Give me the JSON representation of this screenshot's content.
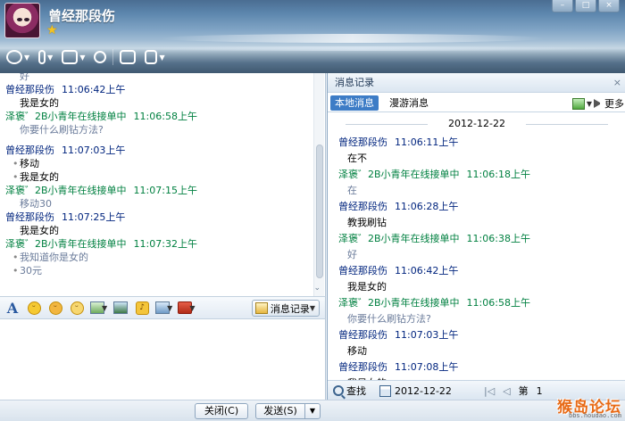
{
  "header": {
    "contact_name": "曾经那段伤",
    "window_controls": [
      "–",
      "□",
      "×"
    ],
    "toolbar": [
      {
        "name": "video-icon"
      },
      {
        "name": "microphone-icon"
      },
      {
        "name": "file-transfer-icon"
      },
      {
        "name": "add-contact-icon"
      },
      {
        "name": "remote-desktop-icon"
      },
      {
        "name": "application-icon"
      }
    ]
  },
  "chat": {
    "messages": [
      {
        "type": "body",
        "role": "other",
        "text": "好"
      },
      {
        "type": "header",
        "role": "me",
        "name": "曾经那段伤",
        "time": "11:06:42上午"
      },
      {
        "type": "body",
        "role": "me",
        "text": "我是女的"
      },
      {
        "type": "header",
        "role": "other",
        "name": "泽褒゛2B小青年在线接单中",
        "time": "11:06:58上午"
      },
      {
        "type": "body",
        "role": "other",
        "text": "你要什么刷钻方法?"
      },
      {
        "type": "gap"
      },
      {
        "type": "header",
        "role": "me",
        "name": "曾经那段伤",
        "time": "11:07:03上午"
      },
      {
        "type": "body",
        "role": "me",
        "dot": true,
        "text": "移动"
      },
      {
        "type": "body",
        "role": "me",
        "dot": true,
        "text": "我是女的"
      },
      {
        "type": "header",
        "role": "other",
        "name": "泽褒゛2B小青年在线接单中",
        "time": "11:07:15上午"
      },
      {
        "type": "body",
        "role": "other",
        "text": "移动30"
      },
      {
        "type": "header",
        "role": "me",
        "name": "曾经那段伤",
        "time": "11:07:25上午"
      },
      {
        "type": "body",
        "role": "me",
        "text": "我是女的"
      },
      {
        "type": "header",
        "role": "other",
        "name": "泽褒゛2B小青年在线接单中",
        "time": "11:07:32上午"
      },
      {
        "type": "body",
        "role": "other",
        "dot": true,
        "text": "我知道你是女的"
      },
      {
        "type": "body",
        "role": "other",
        "dot": true,
        "text": "30元"
      }
    ]
  },
  "input_toolbar": {
    "font_label": "A",
    "history_label": "消息记录"
  },
  "buttons": {
    "close": "关闭(C)",
    "send": "发送(S)",
    "send_dropdown": "▼"
  },
  "history": {
    "title": "消息记录",
    "close": "×",
    "tabs": [
      "本地消息",
      "漫游消息"
    ],
    "more": "更多",
    "date": "2012-12-22",
    "messages": [
      {
        "type": "header",
        "role": "me",
        "name": "曾经那段伤",
        "time": "11:06:11上午"
      },
      {
        "type": "body",
        "role": "me",
        "text": "在不"
      },
      {
        "type": "header",
        "role": "other",
        "name": "泽褒゛2B小青年在线接单中",
        "time": "11:06:18上午"
      },
      {
        "type": "body",
        "role": "other",
        "text": "在"
      },
      {
        "type": "header",
        "role": "me",
        "name": "曾经那段伤",
        "time": "11:06:28上午"
      },
      {
        "type": "body",
        "role": "me",
        "text": "教我刷钻"
      },
      {
        "type": "header",
        "role": "other",
        "name": "泽褒゛2B小青年在线接单中",
        "time": "11:06:38上午"
      },
      {
        "type": "body",
        "role": "other",
        "text": "好"
      },
      {
        "type": "header",
        "role": "me",
        "name": "曾经那段伤",
        "time": "11:06:42上午"
      },
      {
        "type": "body",
        "role": "me",
        "text": "我是女的"
      },
      {
        "type": "header",
        "role": "other",
        "name": "泽褒゛2B小青年在线接单中",
        "time": "11:06:58上午"
      },
      {
        "type": "body",
        "role": "other",
        "text": "你要什么刷钻方法?"
      },
      {
        "type": "header",
        "role": "me",
        "name": "曾经那段伤",
        "time": "11:07:03上午"
      },
      {
        "type": "body",
        "role": "me",
        "text": "移动"
      },
      {
        "type": "header",
        "role": "me",
        "name": "曾经那段伤",
        "time": "11:07:08上午"
      },
      {
        "type": "body",
        "role": "me",
        "text": "我是女的"
      }
    ],
    "footer": {
      "search": "查找",
      "date": "2012-12-22",
      "nav_first": "|◁",
      "nav_prev": "◁",
      "page_prefix": "第",
      "page": "1"
    }
  },
  "watermark": {
    "text": "猴岛论坛",
    "url": "bbs.houdao.com"
  },
  "colors": {
    "self_name": "#00247e",
    "other_name": "#008040",
    "other_text": "#6a7b9a",
    "tab_active": "#3d7cc6"
  }
}
